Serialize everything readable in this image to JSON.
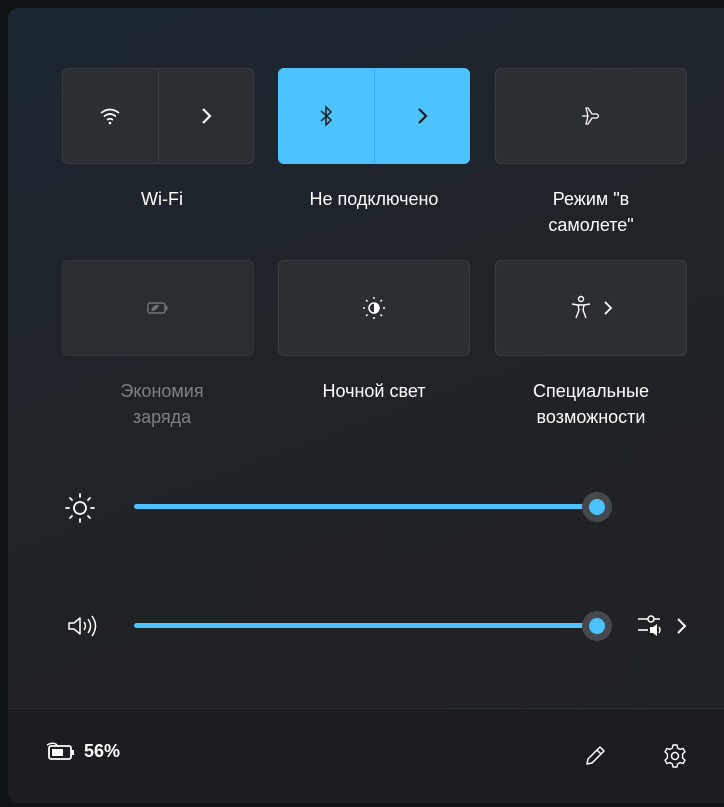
{
  "tiles": {
    "wifi": {
      "label": "Wi-Fi",
      "state": "off"
    },
    "bluetooth": {
      "label": "Не подключено",
      "state": "on"
    },
    "airplane": {
      "label_line1": "Режим \"в",
      "label_line2": "самолете\"",
      "state": "off"
    },
    "battery_saver": {
      "label_line1": "Экономия",
      "label_line2": "заряда",
      "state": "disabled"
    },
    "night_light": {
      "label": "Ночной свет",
      "state": "off"
    },
    "accessibility": {
      "label_line1": "Специальные",
      "label_line2": "возможности",
      "state": "off"
    }
  },
  "sliders": {
    "brightness": {
      "value_percent": 100
    },
    "volume": {
      "value_percent": 100
    }
  },
  "footer": {
    "battery_percent": "56%"
  },
  "colors": {
    "accent": "#4cc2ff",
    "panel_bg": "#202326",
    "tile_bg": "#2b2e33",
    "disabled_text": "#7d8186"
  },
  "icons": [
    "wifi-icon",
    "chevron-right-icon",
    "bluetooth-icon",
    "airplane-icon",
    "battery-saver-icon",
    "night-light-icon",
    "accessibility-icon",
    "brightness-icon",
    "volume-icon",
    "audio-output-icon",
    "battery-icon",
    "pencil-icon",
    "gear-icon"
  ]
}
